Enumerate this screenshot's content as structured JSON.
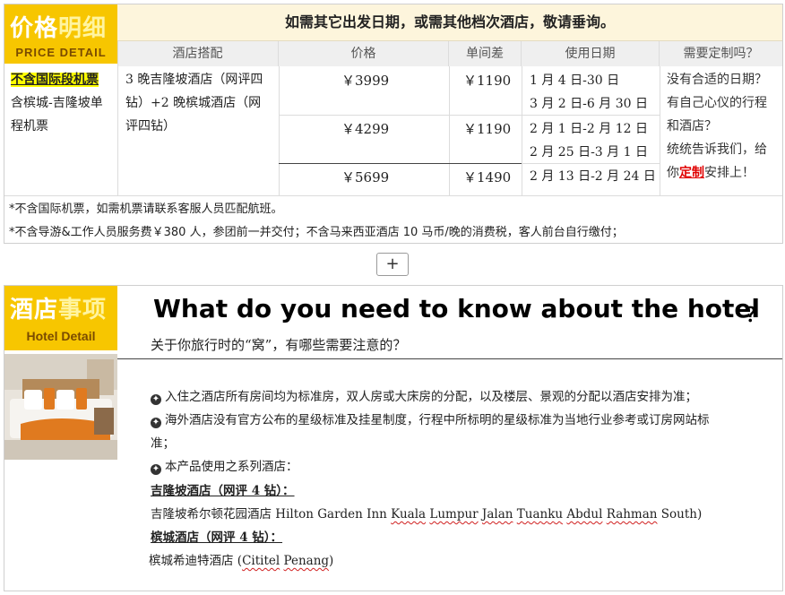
{
  "price_section": {
    "badge_zh_white": "价格",
    "badge_zh_yellow": "明细",
    "badge_en": "PRICE DETAIL",
    "headline": "如需其它出发日期，或需其他档次酒店，敬请垂询。",
    "headers": [
      "酒店搭配",
      "价格",
      "单间差",
      "使用日期",
      "需要定制吗？"
    ],
    "ticket_highlight": "不含国际段机票",
    "ticket_line2": "含槟城-吉隆坡单",
    "ticket_line3": "程机票",
    "hotel_combo_lines": [
      "3 晚吉隆坡酒店（网评四",
      "钻）+2 晚槟城酒店（网",
      "评四钻）"
    ],
    "rows": [
      {
        "price": "￥3999",
        "single_supplement": "￥1190",
        "dates": [
          "1 月 4 日-30 日",
          "3 月 2 日-6 月 30 日"
        ]
      },
      {
        "price": "￥4299",
        "single_supplement": "￥1190",
        "dates": [
          "2 月 1 日-2 月 12 日",
          "2 月 25 日-3 月 1 日"
        ]
      },
      {
        "price": "￥5699",
        "single_supplement": "￥1490",
        "dates": [
          "2 月 13 日-2 月 24 日"
        ]
      }
    ],
    "custom_lines": [
      "没有合适的日期？",
      "有自己心仪的行程",
      "和酒店？",
      "统统告诉我们，给"
    ],
    "custom_last_prefix": "你",
    "custom_last_red": "定制",
    "custom_last_suffix": "安排上！",
    "notes": [
      "*不含国际机票，如需机票请联系客服人员匹配航班。",
      "*不含导游&工作人员服务费￥380 人，参团前一并交付；不含马来西亚酒店 10 马币/晚的消费税，客人前台自行缴付；"
    ]
  },
  "expand_button": {
    "label": "+"
  },
  "hotel_section": {
    "badge_zh_white": "酒店",
    "badge_zh_yellow": "事项",
    "badge_en": "Hotel Detail",
    "title": "What do you need to know about the hotel",
    "title_mark": "？",
    "subtitle": "关于你旅行时的“窝”，有哪些需要注意的？",
    "bullets": [
      "入住之酒店所有房间均为标准房，双人房或大床房的分配，以及楼层、景观的分配以酒店安排为准；",
      "海外酒店没有官方公布的星级标准及挂星制度，行程中所标明的星级标准为当地行业参考或订房网站标",
      "本产品使用之系列酒店："
    ],
    "bullet2_cont": "准；",
    "kl_heading": "吉隆坡酒店（网评 4 钻）：",
    "kl_hotel_zh": "吉隆坡希尔顿花园酒店 Hilton Garden Inn ",
    "kl_hotel_en": [
      "Kuala",
      "Lumpur",
      "Jalan",
      "Tuanku",
      "Abdul",
      "Rahman"
    ],
    "kl_hotel_tail": " South)",
    "penang_heading": "槟城酒店（网评 4 钻）：",
    "penang_hotel_zh": "槟城希迪特酒店  (",
    "penang_hotel_en": [
      "Cititel",
      "Penang"
    ],
    "penang_hotel_tail": ")"
  },
  "colors": {
    "badge": "#f7c600",
    "headline_bg": "#fdf5dc",
    "header_bg": "#efefef",
    "accent_red": "#e00000",
    "highlight": "#ffff00"
  },
  "icons": {
    "bullet": "circled-star-icon",
    "expand": "plus-icon"
  }
}
